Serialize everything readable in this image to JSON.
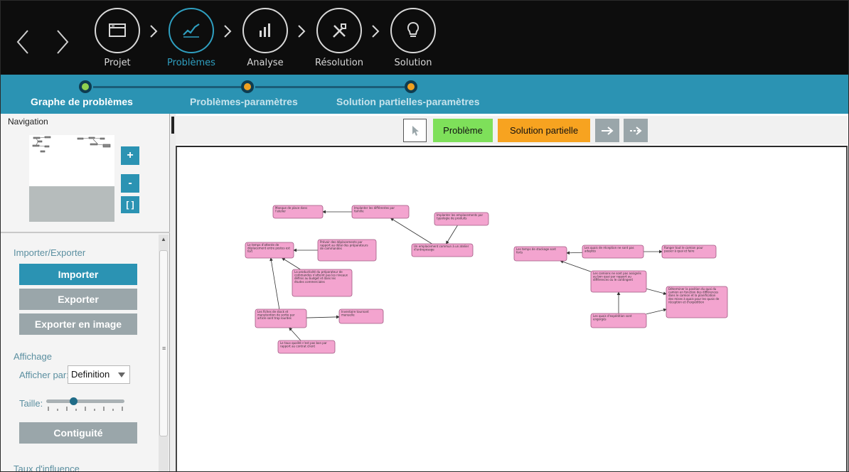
{
  "nav": {
    "back_icon": "chevron-left-icon",
    "forward_icon": "chevron-right-icon",
    "steps": [
      {
        "label": "Projet",
        "icon": "window-icon",
        "active": false
      },
      {
        "label": "Problèmes",
        "icon": "line-chart-icon",
        "active": true
      },
      {
        "label": "Analyse",
        "icon": "bar-chart-icon",
        "active": false
      },
      {
        "label": "Résolution",
        "icon": "tools-icon",
        "active": false
      },
      {
        "label": "Solution",
        "icon": "lightbulb-icon",
        "active": false
      }
    ]
  },
  "substeps": [
    {
      "label": "Graphe de problèmes",
      "dot_color": "#8fd14f",
      "active": true
    },
    {
      "label": "Problèmes-paramètres",
      "dot_color": "#f0a020",
      "active": false
    },
    {
      "label": "Solution partielles-paramètres",
      "dot_color": "#f0a020",
      "active": false
    }
  ],
  "navigation": {
    "title": "Navigation",
    "zoom_in": "+",
    "zoom_out": "-",
    "fit": "[ ]"
  },
  "import_export": {
    "title": "Importer/Exporter",
    "import": "Importer",
    "export": "Exporter",
    "export_image": "Exporter en image"
  },
  "affichage": {
    "title": "Affichage",
    "display_by_label": "Afficher par:",
    "display_by_value": "Definition",
    "size_label": "Taille:",
    "size_level": 0.3,
    "contiguity": "Contiguité"
  },
  "influence": {
    "title": "Taux d'influence"
  },
  "toolbar": {
    "select_icon": "cursor-icon",
    "problem": "Problème",
    "partial_solution": "Solution partielle",
    "arrow_icon": "solid-arrow-icon",
    "dashed_arrow_icon": "dashed-arrow-icon",
    "colors": {
      "problem": "#7ee05a",
      "partial_solution": "#f7a320",
      "arrow_buttons": "#9aa6aa"
    }
  },
  "graph": {
    "node_color": "#f3a4cf",
    "nodes": [
      "Manque de place dans l'atelier",
      "Implanter les différentes par famille",
      "Implanter les emplacements par typologie de produits",
      "Un emplacement commun à un atelier d'entreposage",
      "Le temps d'attente de déplacement entre postes est fort",
      "Prévoir des déplacements par rapport au délai des préparateurs de commandes",
      "La productivité du préparateur de commandes n'atteint pas les niveaux définis au budget et dans les études commerciales",
      "Les fiches de stock et manutention de sortie par article sont trop lourdes",
      "Inventaire tournant manuelle",
      "Le taux qualité n'est pas bon par rapport au contrat client",
      "Les temps de stockage sont forts",
      "Les quais de réception ne sont pas adaptés",
      "Ranger tout le camion pour passer à quai et faire",
      "Les camions ne sont pas assignés au bon quai par rapport au différences ou le contingent",
      "Déterminer la position du quai du camion en fonction des différences dans le camion et la planification des mises à quais pour les quais de réception et d'expédition",
      "Les quais d'expédition sont engorgés"
    ]
  }
}
